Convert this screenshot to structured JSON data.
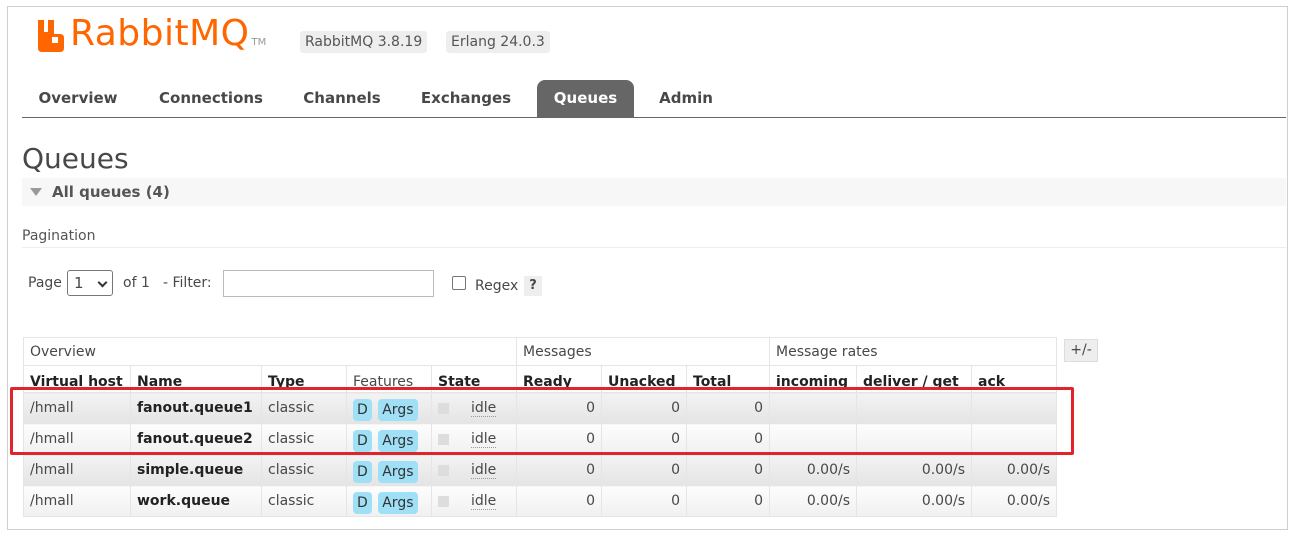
{
  "header": {
    "logo_text": "RabbitMQ",
    "logo_tm": "TM",
    "rabbitmq_version": "RabbitMQ 3.8.19",
    "erlang_version": "Erlang 24.0.3",
    "brand_color": "#ff6600"
  },
  "tabs": [
    {
      "label": "Overview"
    },
    {
      "label": "Connections"
    },
    {
      "label": "Channels"
    },
    {
      "label": "Exchanges"
    },
    {
      "label": "Queues",
      "active": true
    },
    {
      "label": "Admin"
    }
  ],
  "page_title": "Queues",
  "section": {
    "label": "All queues (4)"
  },
  "pagination": {
    "label": "Pagination",
    "page_label": "Page",
    "page_value": "1",
    "of_label": "of 1",
    "filter_label": "- Filter:",
    "filter_value": "",
    "regex_label": "Regex",
    "regex_checked": false,
    "help_label": "?"
  },
  "table": {
    "groups": [
      "Overview",
      "Messages",
      "Message rates"
    ],
    "columns": [
      "Virtual host",
      "Name",
      "Type",
      "Features",
      "State",
      "Ready",
      "Unacked",
      "Total",
      "incoming",
      "deliver / get",
      "ack"
    ],
    "toggle_columns_label": "+/-",
    "rows": [
      {
        "vhost": "/hmall",
        "name": "fanout.queue1",
        "type": "classic",
        "feature_d": "D",
        "feature_args": "Args",
        "state": "idle",
        "ready": "0",
        "unacked": "0",
        "total": "0",
        "incoming": "",
        "deliver_get": "",
        "ack": ""
      },
      {
        "vhost": "/hmall",
        "name": "fanout.queue2",
        "type": "classic",
        "feature_d": "D",
        "feature_args": "Args",
        "state": "idle",
        "ready": "0",
        "unacked": "0",
        "total": "0",
        "incoming": "",
        "deliver_get": "",
        "ack": ""
      },
      {
        "vhost": "/hmall",
        "name": "simple.queue",
        "type": "classic",
        "feature_d": "D",
        "feature_args": "Args",
        "state": "idle",
        "ready": "0",
        "unacked": "0",
        "total": "0",
        "incoming": "0.00/s",
        "deliver_get": "0.00/s",
        "ack": "0.00/s"
      },
      {
        "vhost": "/hmall",
        "name": "work.queue",
        "type": "classic",
        "feature_d": "D",
        "feature_args": "Args",
        "state": "idle",
        "ready": "0",
        "unacked": "0",
        "total": "0",
        "incoming": "0.00/s",
        "deliver_get": "0.00/s",
        "ack": "0.00/s"
      }
    ]
  },
  "highlight_color": "#e0242c"
}
